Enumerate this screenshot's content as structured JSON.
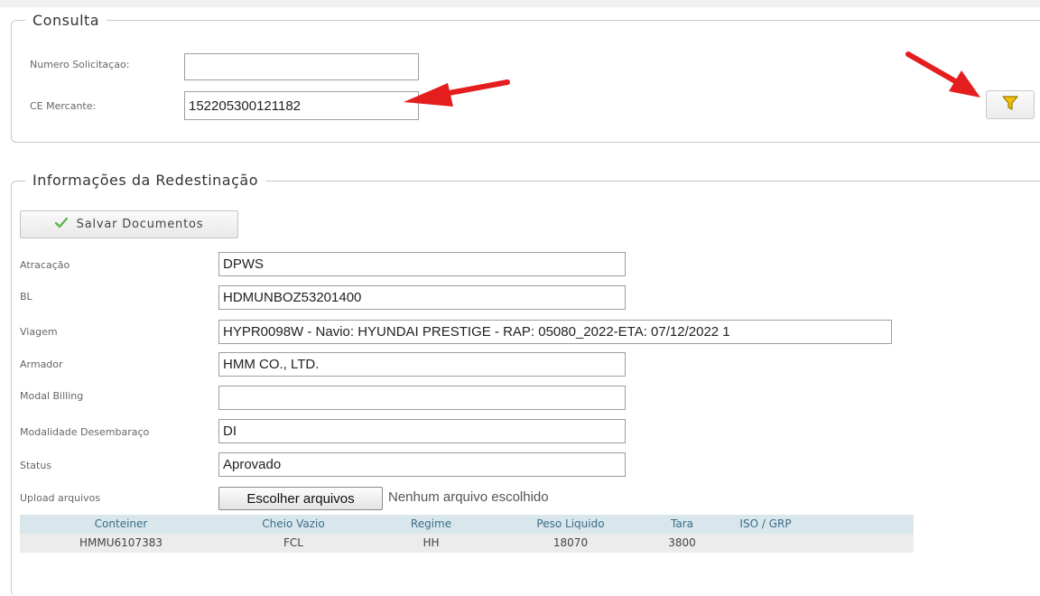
{
  "consulta": {
    "legend": "Consulta",
    "numero_label": "Numero Solicitaçao:",
    "numero_value": "",
    "ce_label": "CE Mercante:",
    "ce_value": "152205300121182"
  },
  "info": {
    "legend": "Informações da Redestinação",
    "save_label": "Salvar Documentos",
    "fields": [
      {
        "label": "Atracação",
        "value": "DPWS"
      },
      {
        "label": "BL",
        "value": "HDMUNBOZ53201400"
      },
      {
        "label": "Viagem",
        "value": "HYPR0098W - Navio: HYUNDAI PRESTIGE - RAP: 05080_2022-ETA: 07/12/2022 1"
      },
      {
        "label": "Armador",
        "value": "HMM CO., LTD."
      },
      {
        "label": "Modal Billing",
        "value": ""
      },
      {
        "label": "Modalidade Desembaraço",
        "value": "DI"
      },
      {
        "label": "Status",
        "value": "Aprovado"
      }
    ],
    "upload_label": "Upload arquivos",
    "upload_button": "Escolher arquivos",
    "upload_status": "Nenhum arquivo escolhido"
  },
  "table": {
    "headers": [
      "Conteiner",
      "Cheio Vazio",
      "Regime",
      "Peso Liquido",
      "Tara",
      "ISO / GRP"
    ],
    "rows": [
      [
        "HMMU6107383",
        "FCL",
        "HH",
        "18070",
        "3800",
        ""
      ]
    ]
  },
  "colors": {
    "table_header_bg": "#d9e7ec",
    "table_header_text": "#3b6c8a",
    "arrow": "#e41e1e",
    "filter_icon": "#f2c200",
    "check_icon": "#5bb84a"
  },
  "icons": {
    "filter": "filter-icon",
    "check": "check-icon",
    "annotation": "red-arrow-icon"
  }
}
